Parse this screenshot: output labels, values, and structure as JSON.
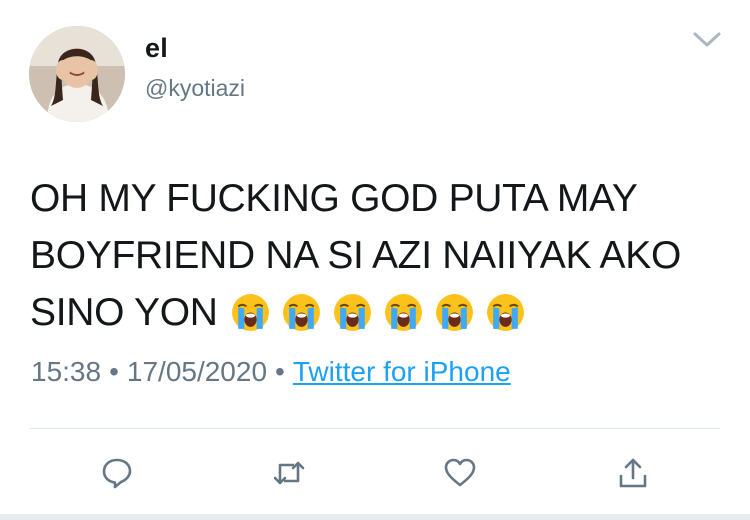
{
  "user": {
    "display_name": "el",
    "handle": "@kyotiazi",
    "avatar_icon": "profile-photo"
  },
  "tweet": {
    "text_lines": [
      "OH MY FUCKING GOD PUTA MAY",
      "BOYFRIEND NA SI AZI NAIIYAK AKO",
      "SINO YON"
    ],
    "emoji": [
      "loudly-crying-face",
      "loudly-crying-face",
      "loudly-crying-face",
      "loudly-crying-face",
      "loudly-crying-face",
      "loudly-crying-face"
    ],
    "time": "15:38",
    "date": "17/05/2020",
    "separator": "•",
    "source": "Twitter for iPhone"
  },
  "actions": [
    {
      "name": "reply",
      "icon": "reply-icon"
    },
    {
      "name": "retweet",
      "icon": "retweet-icon"
    },
    {
      "name": "like",
      "icon": "heart-icon"
    },
    {
      "name": "share",
      "icon": "share-icon"
    }
  ],
  "colors": {
    "text": "#14171a",
    "secondary": "#657786",
    "link": "#1da1f2",
    "divider": "#e1e8ed"
  }
}
